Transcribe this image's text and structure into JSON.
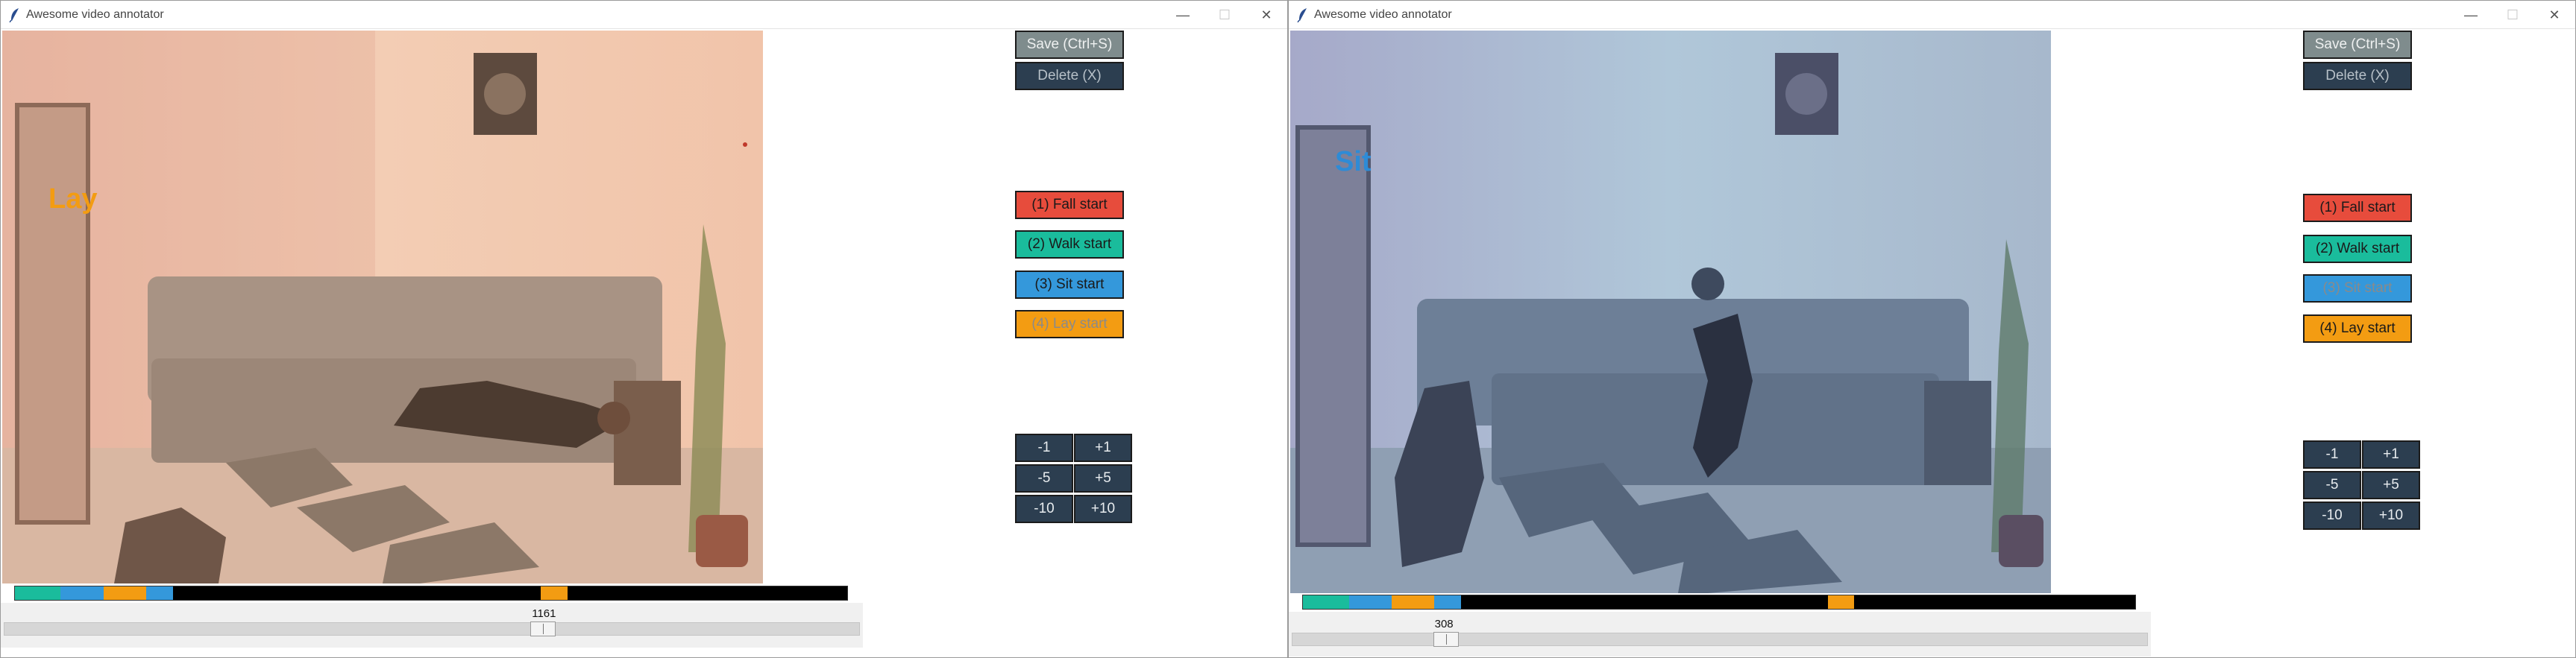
{
  "windows": [
    {
      "title": "Awesome video annotator",
      "overlay_label": "Lay",
      "buttons": {
        "save": "Save (Ctrl+S)",
        "delete": "Delete (X)",
        "fall": "(1) Fall start",
        "walk": "(2) Walk start",
        "sit": "(3) Sit start",
        "lay": "(4) Lay start"
      },
      "steps": [
        "-1",
        "+1",
        "-5",
        "+5",
        "-10",
        "+10"
      ],
      "slider_value": "1161",
      "slider_fraction": 0.63,
      "timeline": [
        {
          "label": "walk",
          "start": 0.0,
          "end": 0.055,
          "color": "#1abc9c"
        },
        {
          "label": "sit",
          "start": 0.055,
          "end": 0.107,
          "color": "#3498db"
        },
        {
          "label": "lay",
          "start": 0.107,
          "end": 0.158,
          "color": "#f39c12"
        },
        {
          "label": "sit",
          "start": 0.158,
          "end": 0.19,
          "color": "#3498db"
        },
        {
          "label": "lay",
          "start": 0.632,
          "end": 0.664,
          "color": "#f39c12"
        }
      ]
    },
    {
      "title": "Awesome video annotator",
      "overlay_label": "Sit",
      "buttons": {
        "save": "Save (Ctrl+S)",
        "delete": "Delete (X)",
        "fall": "(1) Fall start",
        "walk": "(2) Walk start",
        "sit": "(3) Sit start",
        "lay": "(4) Lay start"
      },
      "steps": [
        "-1",
        "+1",
        "-5",
        "+5",
        "-10",
        "+10"
      ],
      "slider_value": "308",
      "slider_fraction": 0.18,
      "timeline": [
        {
          "label": "walk",
          "start": 0.0,
          "end": 0.056,
          "color": "#1abc9c"
        },
        {
          "label": "sit",
          "start": 0.056,
          "end": 0.107,
          "color": "#3498db"
        },
        {
          "label": "lay",
          "start": 0.107,
          "end": 0.158,
          "color": "#f39c12"
        },
        {
          "label": "sit",
          "start": 0.158,
          "end": 0.19,
          "color": "#3498db"
        },
        {
          "label": "lay",
          "start": 0.631,
          "end": 0.662,
          "color": "#f39c12"
        }
      ]
    }
  ],
  "colors": {
    "fall": "#e74c3c",
    "walk": "#1abc9c",
    "sit": "#3498db",
    "lay": "#f39c12",
    "dark_button": "#2c3e50",
    "save_button": "#7f8c8d"
  },
  "icons": {
    "app": "feather-icon",
    "minimize": "minimize-icon",
    "maximize": "maximize-icon",
    "close": "close-icon"
  }
}
